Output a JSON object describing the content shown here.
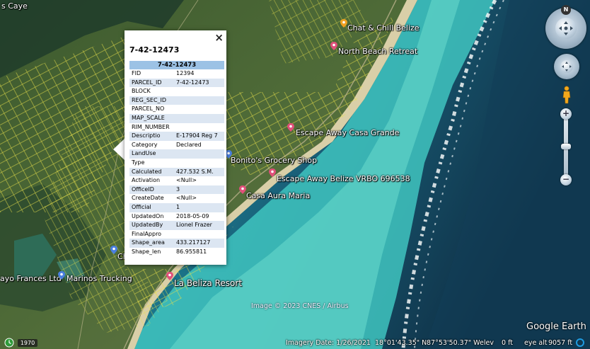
{
  "map": {
    "corner_label": "s Caye",
    "places": [
      {
        "name": "Chat & Chill Belize",
        "pin": "orange"
      },
      {
        "name": "North Beach Retreat",
        "pin": "pink"
      },
      {
        "name": "Escape Away Casa Grande",
        "pin": "pink"
      },
      {
        "name": "Bonito's Grocery Shop",
        "pin": "blue"
      },
      {
        "name": "Escape Away Belize VRBO 696538",
        "pin": "pink"
      },
      {
        "name": "Casa Aura Maria",
        "pin": "pink"
      },
      {
        "name": "La Beliza Resort",
        "pin": "pink"
      },
      {
        "name": "ayo Frances Ltd",
        "pin": "none"
      },
      {
        "name": "Marinos Trucking",
        "pin": "blue"
      },
      {
        "name": "Ch",
        "pin": "blue"
      }
    ],
    "copyright": "Image © 2023 CNES / Airbus",
    "brand": "Google Earth",
    "colors": {
      "pin_pink": "#e0507a",
      "pin_orange": "#f0a020",
      "pin_blue": "#4a7fe0",
      "parcel_lines": "#e6e04a",
      "popup_header": "#9cc2e5",
      "popup_alt_row": "#dce6f2"
    }
  },
  "popup": {
    "close_label": "×",
    "title": "7-42-12473",
    "table_header": "7-42-12473",
    "rows": [
      {
        "key": "FID",
        "value": "12394"
      },
      {
        "key": "PARCEL_ID",
        "value": "7-42-12473"
      },
      {
        "key": "BLOCK",
        "value": ""
      },
      {
        "key": "REG_SEC_ID",
        "value": ""
      },
      {
        "key": "PARCEL_NO",
        "value": ""
      },
      {
        "key": "MAP_SCALE",
        "value": ""
      },
      {
        "key": "RIM_NUMBER",
        "value": ""
      },
      {
        "key": "Descriptio",
        "value": "E-17904 Reg 7"
      },
      {
        "key": "Category",
        "value": "Declared"
      },
      {
        "key": "LandUse",
        "value": ""
      },
      {
        "key": "Type",
        "value": ""
      },
      {
        "key": "Calculated",
        "value": "427.532 S.M."
      },
      {
        "key": "Activation",
        "value": "<Null>"
      },
      {
        "key": "OfficeID",
        "value": "3"
      },
      {
        "key": "CreateDate",
        "value": "<Null>"
      },
      {
        "key": "Official",
        "value": "1"
      },
      {
        "key": "UpdatedOn",
        "value": "2018-05-09"
      },
      {
        "key": "UpdatedBy",
        "value": "Lionel Frazer"
      },
      {
        "key": "FinalAppro",
        "value": ""
      },
      {
        "key": "Shape_area",
        "value": "433.217127"
      },
      {
        "key": "Shape_len",
        "value": "86.955811"
      }
    ]
  },
  "controls": {
    "compass_letter": "N",
    "zoom_in": "+",
    "zoom_out": "−"
  },
  "status": {
    "year": "1970",
    "imagery_date": "Imagery Date: 1/26/2021",
    "latitude": "18°01'43.35\" N",
    "longitude": "87°53'50.37\" W",
    "elev_label": "elev",
    "elev_value": "0 ft",
    "eye_alt_label": "eye alt",
    "eye_alt_value": "9057 ft"
  }
}
